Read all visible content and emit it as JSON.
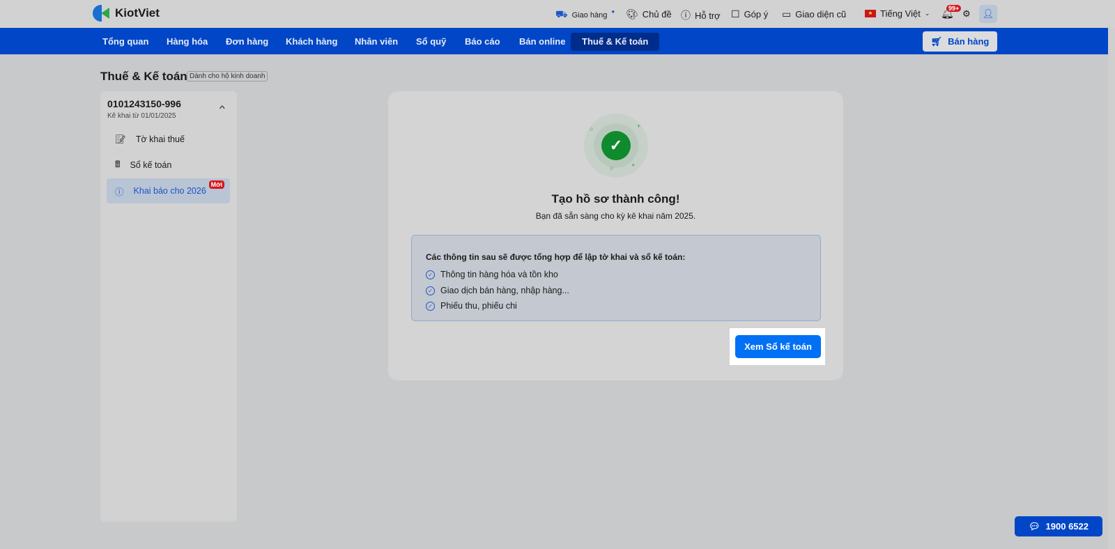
{
  "brand": "KiotViet",
  "topbar": {
    "delivery": "Giao hàng",
    "theme": "Chủ đề",
    "support": "Hỗ trợ",
    "feedback": "Góp ý",
    "old_ui": "Giao diện cũ",
    "language": "Tiếng Việt",
    "notif_count": "99+"
  },
  "nav": {
    "items": [
      "Tổng quan",
      "Hàng hóa",
      "Đơn hàng",
      "Khách hàng",
      "Nhân viên",
      "Sổ quỹ",
      "Báo cáo",
      "Bán online",
      "Thuế & Kế toán"
    ],
    "sell": "Bán hàng"
  },
  "page": {
    "title": "Thuế & Kế toán",
    "tag": "Dành cho hộ kinh doanh"
  },
  "sidebar": {
    "tax_code": "0101243150-996",
    "since": "Kê khai từ 01/01/2025",
    "items": [
      {
        "label": "Tờ khai thuế"
      },
      {
        "label": "Sổ kế toán"
      },
      {
        "label": "Khai báo cho 2026",
        "badge": "Mới"
      }
    ]
  },
  "main": {
    "title": "Tạo hồ sơ thành công!",
    "subtitle": "Bạn đã sẵn sàng cho kỳ kê khai năm 2025.",
    "info_heading": "Các thông tin sau sẽ được tổng hợp để lập tờ khai và sổ kế toán:",
    "info_items": [
      "Thông tin hàng hóa và tồn kho",
      "Giao dịch bán hàng, nhập hàng...",
      "Phiếu thu, phiếu chi"
    ],
    "button": "Xem Sổ kế toán"
  },
  "hotline": "1900 6522"
}
